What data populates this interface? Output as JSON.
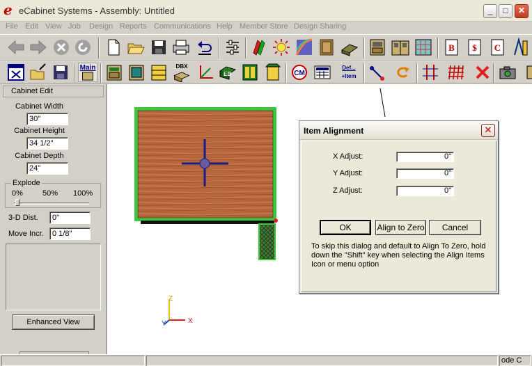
{
  "window": {
    "logo_letter": "e",
    "title": "eCabinet Systems - Assembly: Untitled",
    "minimize_glyph": "_",
    "maximize_glyph": "□",
    "close_glyph": "✕"
  },
  "menu": [
    "File",
    "Edit",
    "View",
    "Job",
    "Design",
    "Reports",
    "Communications",
    "Help",
    "Member Store",
    "Design Sharing"
  ],
  "toolbar2": {
    "main_label": "Main",
    "dbx_label": "DBX",
    "eb_label": "EB",
    "def_line1": "Def...",
    "def_line2": "+Item"
  },
  "left_panel": {
    "title": "Cabinet Edit",
    "width_label": "Cabinet Width",
    "width_value": "30\"",
    "height_label": "Cabinet Height",
    "height_value": "34 1/2\"",
    "depth_label": "Cabinet Depth",
    "depth_value": "24\"",
    "explode": {
      "title": "Explode",
      "tick_0": "0%",
      "tick_50": "50%",
      "tick_100": "100%",
      "value_percent": 0
    },
    "dist_label": "3-D Dist.",
    "dist_value": "0\"",
    "move_label": "Move Incr.",
    "move_value": "0 1/8\"",
    "enhanced_view_button": "Enhanced View"
  },
  "axes": {
    "x": "X",
    "y": "Y",
    "z": "Z"
  },
  "dialog": {
    "title": "Item Alignment",
    "close_glyph": "✕",
    "x_label": "X Adjust:",
    "x_value": "0\"",
    "y_label": "Y Adjust:",
    "y_value": "0\"",
    "z_label": "Z Adjust:",
    "z_value": "0\"",
    "ok_button": "OK",
    "align_zero_button": "Align to Zero",
    "cancel_button": "Cancel",
    "hint": "To skip this dialog and default to Align To Zero, hold down the \"Shift\" key when selecting the Align Items Icon or menu option"
  },
  "status": {
    "mode_text": "ode C"
  },
  "colors": {
    "wood": "#b5663d",
    "cabinet_outline": "#3cc83c",
    "crosshair": "#1a1a8a",
    "close_red": "#c23b22"
  }
}
